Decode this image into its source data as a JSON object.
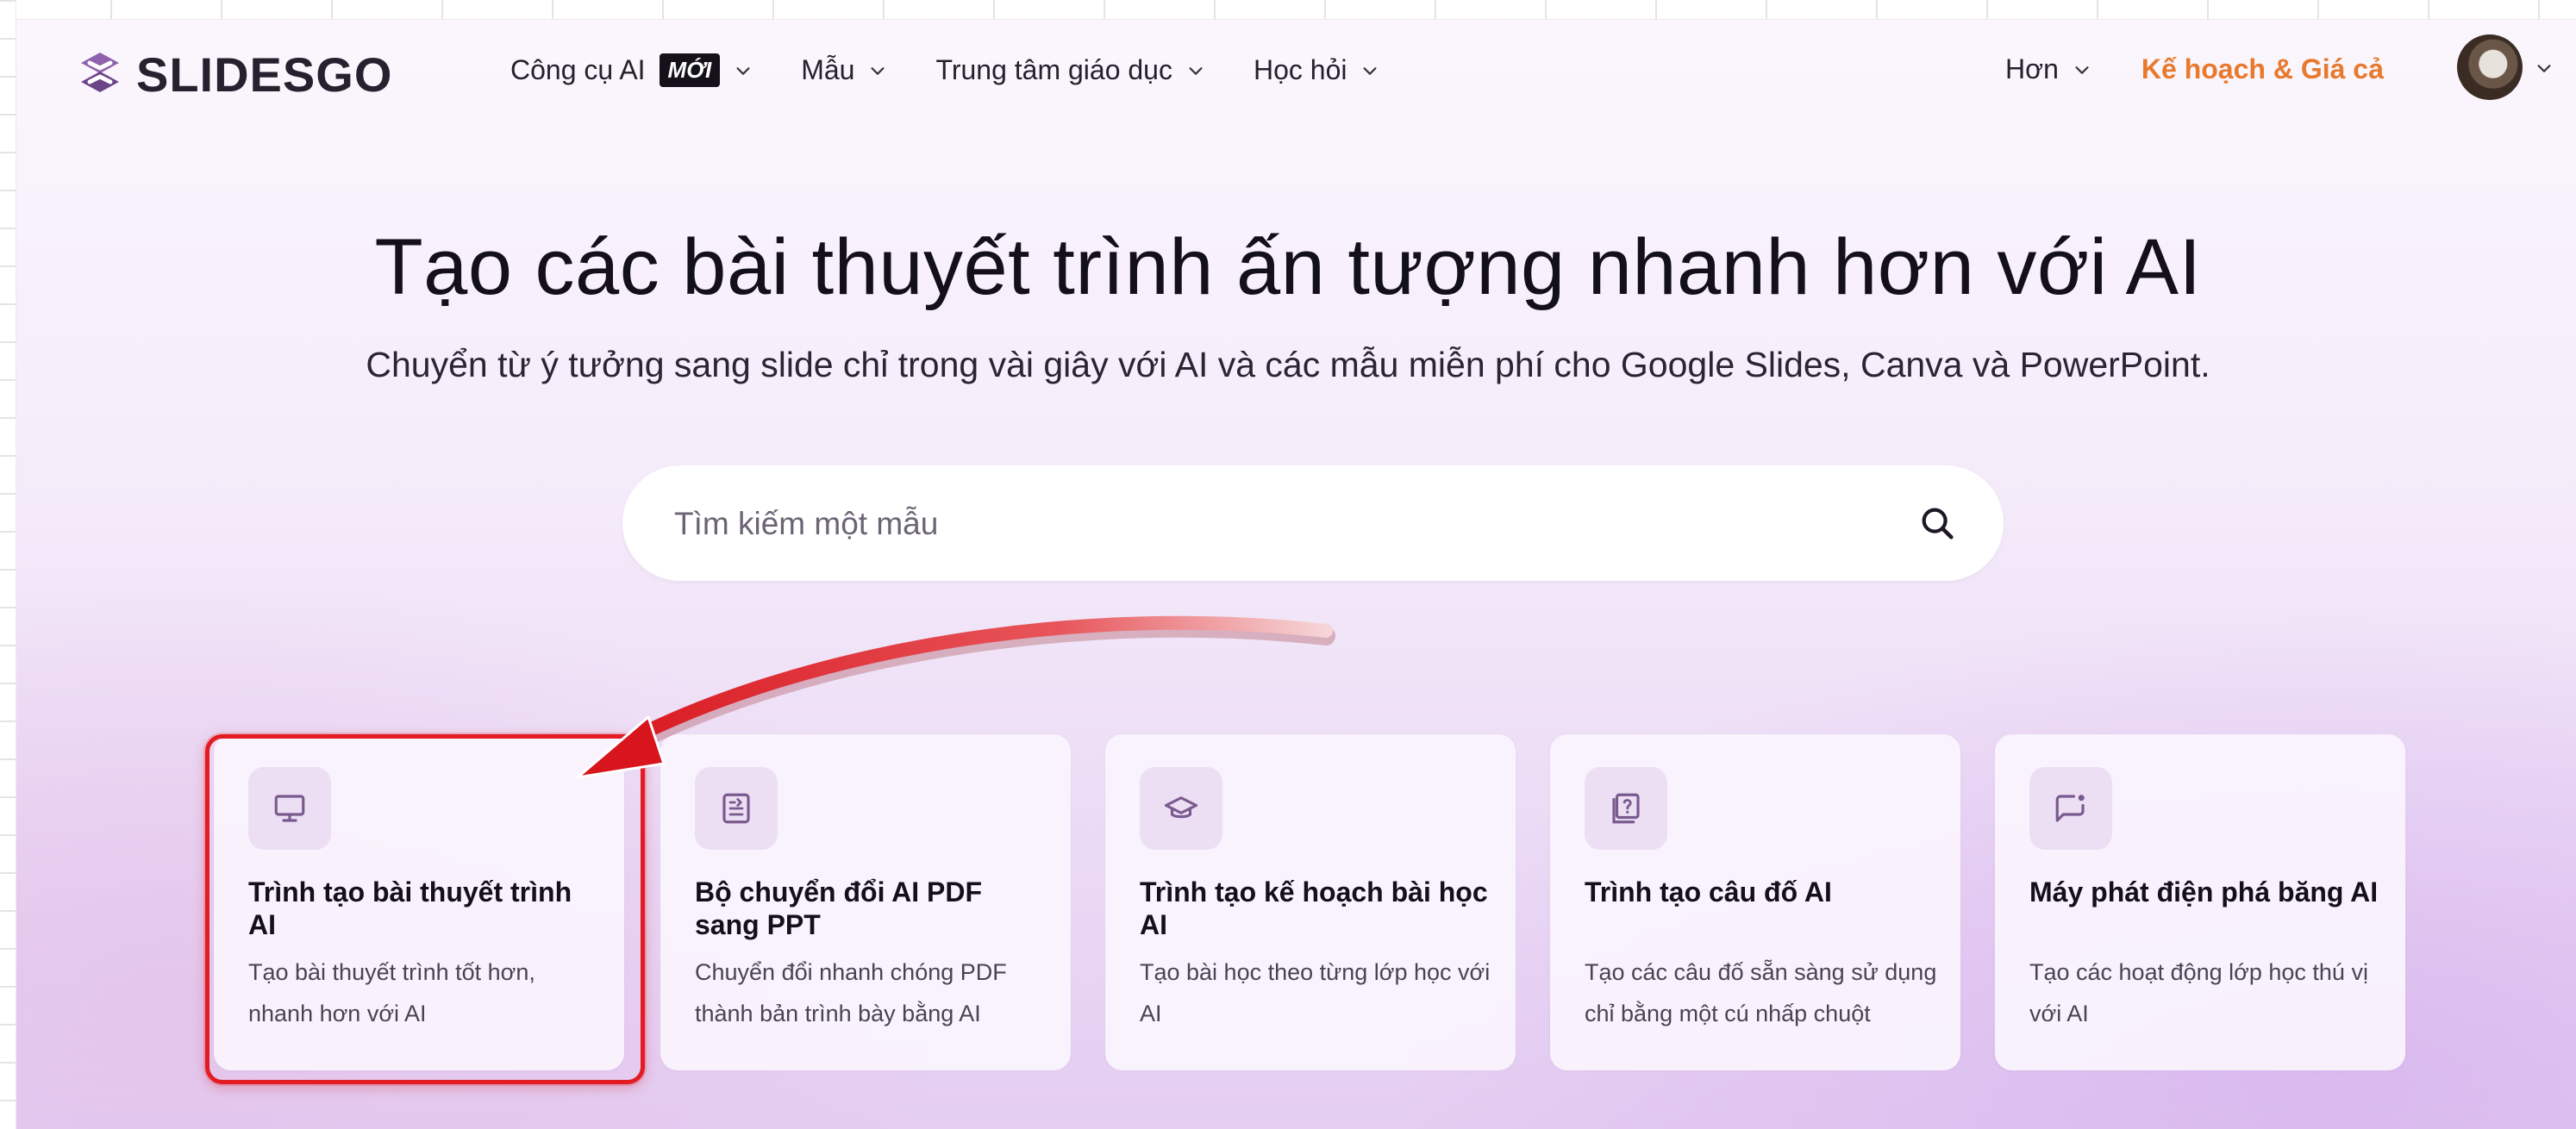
{
  "brand": {
    "logo_text": "SLIDESGO",
    "logo_icon": "slidesgo-s-icon"
  },
  "nav": {
    "items": [
      {
        "label": "Công cụ AI",
        "badge": "MỚI"
      },
      {
        "label": "Mẫu"
      },
      {
        "label": "Trung tâm giáo dục"
      },
      {
        "label": "Học hỏi"
      }
    ],
    "more_label": "Hơn",
    "plans_label": "Kế hoạch & Giá cả"
  },
  "hero": {
    "title": "Tạo các bài thuyết trình ấn tượng nhanh hơn với AI",
    "subtitle": "Chuyển từ ý tưởng sang slide chỉ trong vài giây với AI và các mẫu miễn phí cho Google Slides, Canva và PowerPoint."
  },
  "search": {
    "placeholder": "Tìm kiếm một mẫu",
    "value": ""
  },
  "cards": [
    {
      "icon": "presentation-monitor-icon",
      "title": "Trình tạo bài thuyết trình AI",
      "desc": "Tạo bài thuyết trình tốt hơn, nhanh hơn với AI"
    },
    {
      "icon": "pdf-convert-icon",
      "title": "Bộ chuyển đổi AI PDF sang PPT",
      "desc": "Chuyển đổi nhanh chóng PDF thành bản trình bày bằng AI"
    },
    {
      "icon": "graduation-cap-icon",
      "title": "Trình tạo kế hoạch bài học AI",
      "desc": "Tạo bài học theo từng lớp học với AI"
    },
    {
      "icon": "quiz-question-icon",
      "title": "Trình tạo câu đố AI",
      "desc": "Tạo các câu đố sẵn sàng sử dụng chỉ bằng một cú nhấp chuột"
    },
    {
      "icon": "chat-spark-icon",
      "title": "Máy phát điện phá băng AI",
      "desc": "Tạo các hoạt động lớp học thú vị với AI"
    }
  ],
  "colors": {
    "accent_orange": "#e8792d",
    "annotation_red": "#e31b23",
    "icon_purple": "#7a5a8e",
    "badge_bg": "#15111a"
  }
}
